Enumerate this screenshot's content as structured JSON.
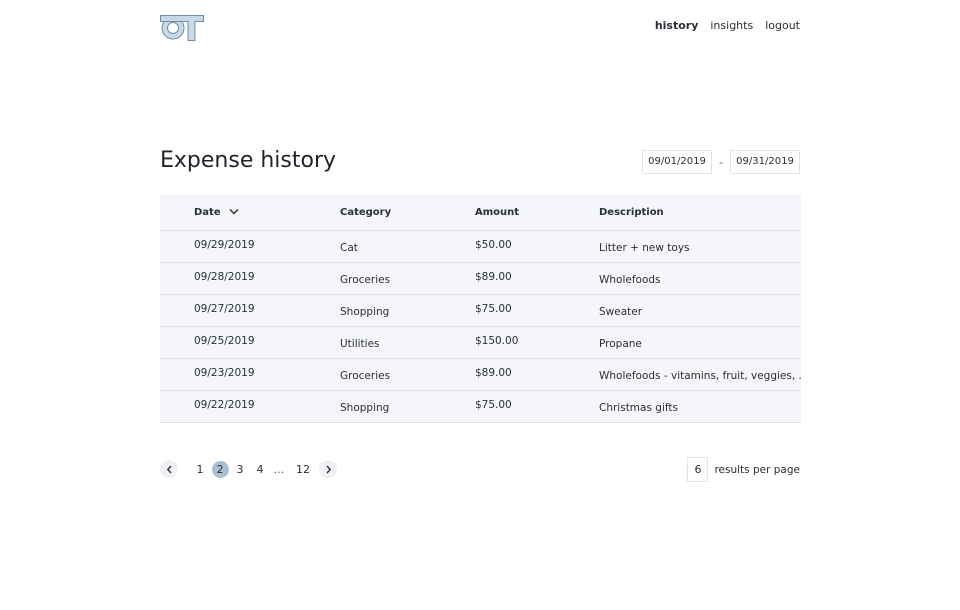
{
  "header": {
    "logo_text": "OT",
    "nav": [
      {
        "label": "history",
        "active": true
      },
      {
        "label": "insights",
        "active": false
      },
      {
        "label": "logout",
        "active": false
      }
    ]
  },
  "main": {
    "title": "Expense history",
    "date_from": "09/01/2019",
    "date_separator": "-",
    "date_to": "09/31/2019"
  },
  "table": {
    "columns": [
      "Date",
      "Category",
      "Amount",
      "Description"
    ],
    "sort_icon": "chevron-down-icon",
    "rows": [
      [
        "09/29/2019",
        "Cat",
        "$50.00",
        "Litter + new toys"
      ],
      [
        "09/28/2019",
        "Groceries",
        "$89.00",
        "Wholefoods"
      ],
      [
        "09/27/2019",
        "Shopping",
        "$75.00",
        "Sweater"
      ],
      [
        "09/25/2019",
        "Utilities",
        "$150.00",
        "Propane"
      ],
      [
        "09/23/2019",
        "Groceries",
        "$89.00",
        "Wholefoods - vitamins, fruit, veggies, ..."
      ],
      [
        "09/22/2019",
        "Shopping",
        "$75.00",
        "Christmas gifts"
      ]
    ]
  },
  "pagination": {
    "pages": [
      "1",
      "2",
      "3",
      "4"
    ],
    "current": "2",
    "ellipsis": "...",
    "last": "12",
    "prev_icon": "chevron-left-icon",
    "next_icon": "chevron-right-icon"
  },
  "per_page": {
    "value": "6",
    "label": "results per page"
  },
  "colors": {
    "accent": "#a9bfd3",
    "logo": "#a9bfd3",
    "table_bg": "#f4f6fa"
  }
}
